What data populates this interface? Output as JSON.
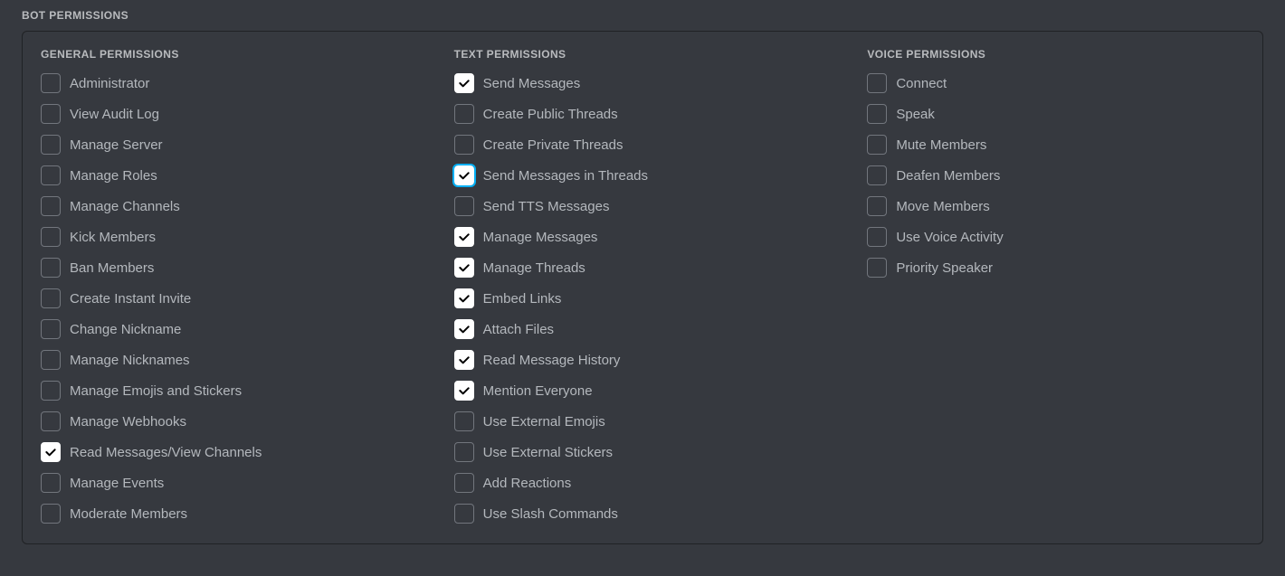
{
  "section_title": "BOT PERMISSIONS",
  "columns": [
    {
      "key": "general",
      "title": "GENERAL PERMISSIONS",
      "items": [
        {
          "label": "Administrator",
          "checked": false
        },
        {
          "label": "View Audit Log",
          "checked": false
        },
        {
          "label": "Manage Server",
          "checked": false
        },
        {
          "label": "Manage Roles",
          "checked": false
        },
        {
          "label": "Manage Channels",
          "checked": false
        },
        {
          "label": "Kick Members",
          "checked": false
        },
        {
          "label": "Ban Members",
          "checked": false
        },
        {
          "label": "Create Instant Invite",
          "checked": false
        },
        {
          "label": "Change Nickname",
          "checked": false
        },
        {
          "label": "Manage Nicknames",
          "checked": false
        },
        {
          "label": "Manage Emojis and Stickers",
          "checked": false
        },
        {
          "label": "Manage Webhooks",
          "checked": false
        },
        {
          "label": "Read Messages/View Channels",
          "checked": true
        },
        {
          "label": "Manage Events",
          "checked": false
        },
        {
          "label": "Moderate Members",
          "checked": false
        }
      ]
    },
    {
      "key": "text",
      "title": "TEXT PERMISSIONS",
      "items": [
        {
          "label": "Send Messages",
          "checked": true
        },
        {
          "label": "Create Public Threads",
          "checked": false
        },
        {
          "label": "Create Private Threads",
          "checked": false
        },
        {
          "label": "Send Messages in Threads",
          "checked": true,
          "highlight": true
        },
        {
          "label": "Send TTS Messages",
          "checked": false
        },
        {
          "label": "Manage Messages",
          "checked": true
        },
        {
          "label": "Manage Threads",
          "checked": true
        },
        {
          "label": "Embed Links",
          "checked": true
        },
        {
          "label": "Attach Files",
          "checked": true
        },
        {
          "label": "Read Message History",
          "checked": true
        },
        {
          "label": "Mention Everyone",
          "checked": true
        },
        {
          "label": "Use External Emojis",
          "checked": false
        },
        {
          "label": "Use External Stickers",
          "checked": false
        },
        {
          "label": "Add Reactions",
          "checked": false
        },
        {
          "label": "Use Slash Commands",
          "checked": false
        }
      ]
    },
    {
      "key": "voice",
      "title": "VOICE PERMISSIONS",
      "items": [
        {
          "label": "Connect",
          "checked": false
        },
        {
          "label": "Speak",
          "checked": false
        },
        {
          "label": "Mute Members",
          "checked": false
        },
        {
          "label": "Deafen Members",
          "checked": false
        },
        {
          "label": "Move Members",
          "checked": false
        },
        {
          "label": "Use Voice Activity",
          "checked": false
        },
        {
          "label": "Priority Speaker",
          "checked": false
        }
      ]
    }
  ]
}
